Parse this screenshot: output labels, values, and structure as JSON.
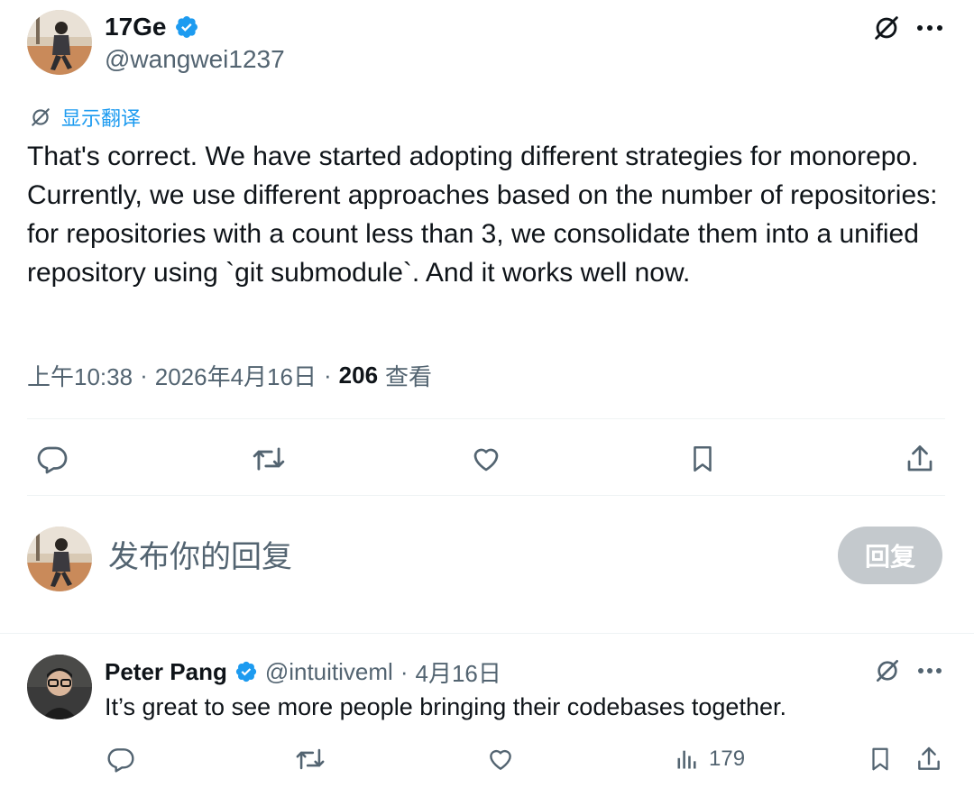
{
  "main_post": {
    "display_name": "17Ge",
    "handle": "@wangwei1237",
    "translate_label": "显示翻译",
    "text": "That's correct. We have started adopting different strategies for monorepo. Currently, we use different approaches based on the number of repositories: for repositories with a count less than 3, we consolidate them into a unified repository using `git submodule`. And it works well now.",
    "time": "上午10:38",
    "date": "2026年4月16日",
    "sep": "·",
    "views_count": "206",
    "views_label": "查看"
  },
  "compose": {
    "placeholder": "发布你的回复",
    "reply_button": "回复"
  },
  "reply_post": {
    "display_name": "Peter Pang",
    "handle": "@intuitiveml",
    "sep": "·",
    "date": "4月16日",
    "text": "It’s great to see more people bringing their codebases together.",
    "views": "179"
  },
  "colors": {
    "verified": "#1d9bf0",
    "link": "#1d9bf0",
    "secondary_text": "#536471",
    "reply_button_disabled": "#c4c9cd"
  },
  "icons": [
    "verified-badge-icon",
    "grok-icon",
    "more-icon",
    "translate-icon",
    "reply-icon",
    "retweet-icon",
    "like-icon",
    "bookmark-icon",
    "share-icon",
    "views-icon"
  ]
}
